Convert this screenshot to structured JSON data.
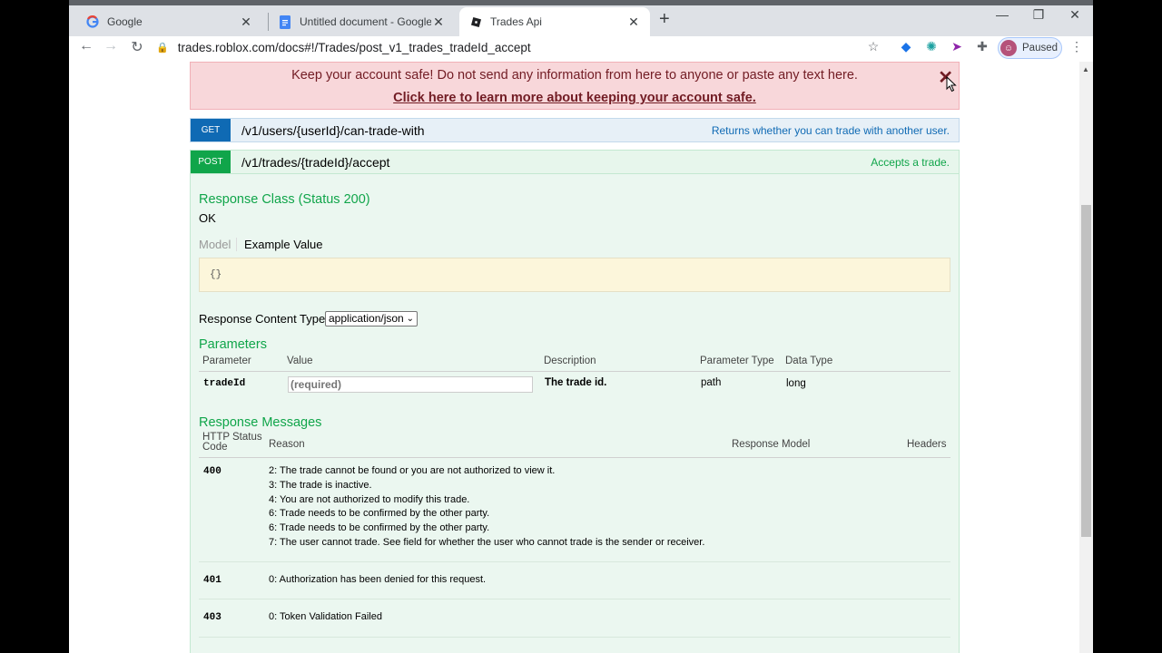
{
  "browser": {
    "tabs": [
      {
        "title": "Google",
        "icon": "google-g-icon"
      },
      {
        "title": "Untitled document - Google Docs",
        "icon": "docs-icon"
      },
      {
        "title": "Trades Api",
        "icon": "roblox-icon"
      }
    ],
    "url": "trades.roblox.com/docs#!/Trades/post_v1_trades_tradeId_accept",
    "profile_label": "Paused"
  },
  "banner": {
    "message": "Keep your account safe! Do not send any information from here to anyone or paste any text here.",
    "link": "Click here to learn more about keeping your account safe."
  },
  "operations": [
    {
      "method": "GET",
      "path": "/v1/users/{userId}/can-trade-with",
      "summary": "Returns whether you can trade with another user."
    },
    {
      "method": "POST",
      "path": "/v1/trades/{tradeId}/accept",
      "summary": "Accepts a trade."
    }
  ],
  "response_class": {
    "heading": "Response Class (Status 200)",
    "status": "OK",
    "model_tab": "Model",
    "example_tab": "Example Value",
    "example": "{}"
  },
  "content_type": {
    "label": "Response Content Type",
    "selected": "application/json"
  },
  "parameters": {
    "heading": "Parameters",
    "columns": [
      "Parameter",
      "Value",
      "Description",
      "Parameter Type",
      "Data Type"
    ],
    "rows": [
      {
        "name": "tradeId",
        "placeholder": "(required)",
        "description": "The trade id.",
        "param_type": "path",
        "data_type": "long"
      }
    ]
  },
  "response_messages": {
    "heading": "Response Messages",
    "columns": [
      "HTTP Status Code",
      "Reason",
      "Response Model",
      "Headers"
    ],
    "rows": [
      {
        "code": "400",
        "reasons": [
          "2: The trade cannot be found or you are not authorized to view it.",
          "3: The trade is inactive.",
          "4: You are not authorized to modify this trade.",
          "6: Trade needs to be confirmed by the other party.",
          "6: Trade needs to be confirmed by the other party.",
          "7: The user cannot trade. See field for whether the user who cannot trade is the sender or receiver."
        ]
      },
      {
        "code": "401",
        "reasons": [
          "0: Authorization has been denied for this request."
        ]
      },
      {
        "code": "403",
        "reasons": [
          "0: Token Validation Failed"
        ]
      }
    ]
  },
  "colors": {
    "get": "#0f6ab4",
    "post": "#10a54a",
    "banner_bg": "#f8d7da"
  }
}
